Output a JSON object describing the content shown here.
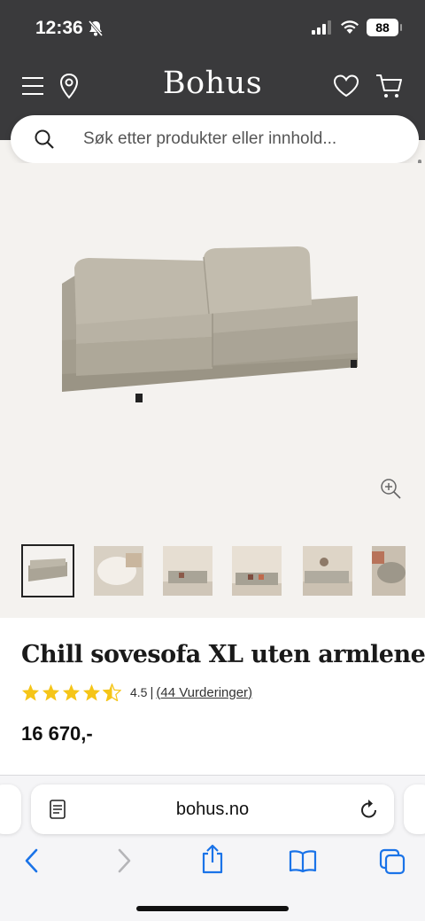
{
  "status": {
    "time": "12:36",
    "battery": "88"
  },
  "header": {
    "brand": "Bohus"
  },
  "search": {
    "placeholder": "Søk etter produkter eller innhold..."
  },
  "product": {
    "title": "Chill sovesofa XL uten armlene",
    "rating_value": "4.5",
    "rating_separator": "|",
    "rating_count": "(44 Vurderinger)",
    "price": "16 670,-",
    "stars": 4.5
  },
  "browser": {
    "url": "bohus.no"
  },
  "colors": {
    "header_bg": "#3a3a3c",
    "star": "#f5c518",
    "link": "#1a73e8"
  },
  "icons": [
    "menu-icon",
    "location-pin-icon",
    "heart-icon",
    "cart-icon",
    "search-icon",
    "zoom-in-icon",
    "reader-icon",
    "reload-icon",
    "back-icon",
    "forward-icon",
    "share-icon",
    "bookmarks-icon",
    "tabs-icon"
  ]
}
